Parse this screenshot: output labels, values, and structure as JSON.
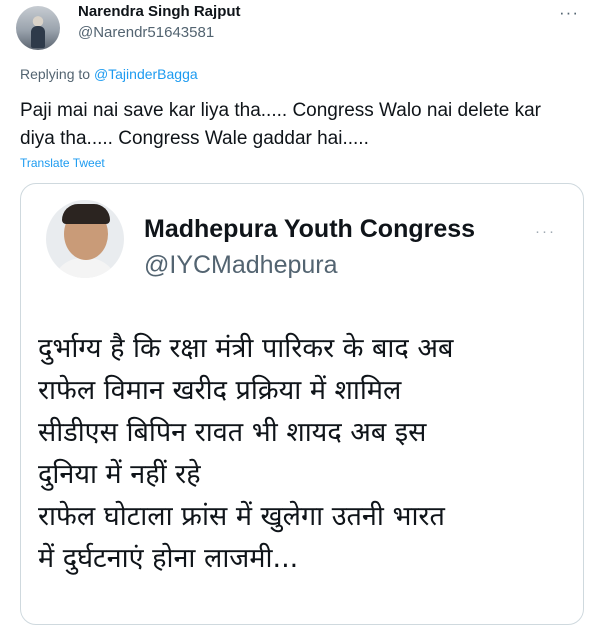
{
  "tweet": {
    "author_name": "Narendra Singh Rajput",
    "author_handle": "@Narendr51643581",
    "more_label": "···",
    "replying_prefix": "Replying to ",
    "replying_to": "@TajinderBagga",
    "text": "Paji mai nai save kar liya tha..... Congress Walo nai delete kar diya tha..... Congress Wale gaddar hai.....",
    "translate_label": "Translate Tweet"
  },
  "embedded": {
    "author_name": "Madhepura Youth Congress",
    "author_handle": "@IYCMadhepura",
    "more_label": "···",
    "lines": [
      "दुर्भाग्य है कि रक्षा मंत्री पारिकर के बाद अब",
      "राफेल विमान खरीद प्रक्रिया में शामिल",
      "सीडीएस बिपिन रावत भी शायद अब इस",
      "दुनिया में नहीं रहे",
      "राफेल घोटाला फ्रांस में खुलेगा उतनी भारत",
      "में दुर्घटनाएं होना लाजमी..."
    ]
  },
  "icons": {
    "author_avatar": "avatar-photo",
    "more": "more-horizontal-icon"
  },
  "colors": {
    "link": "#1d9bf0",
    "secondary_text": "#536471",
    "border": "#cfd9de"
  }
}
